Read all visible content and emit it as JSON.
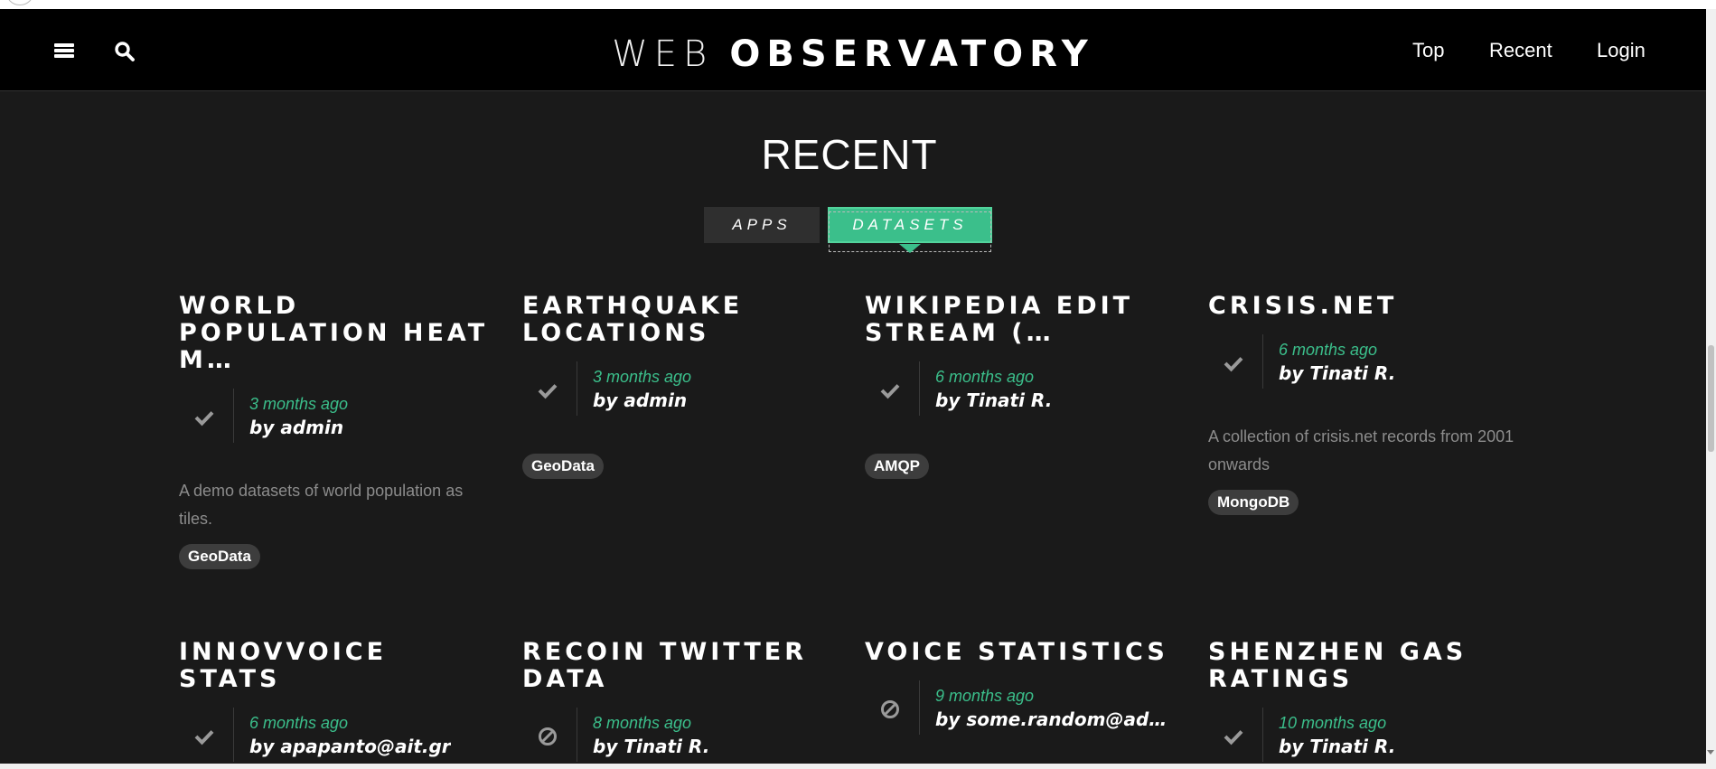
{
  "header": {
    "brand_light": "WEB",
    "brand_bold": "OBSERVATORY",
    "nav": [
      {
        "label": "Top"
      },
      {
        "label": "Recent"
      },
      {
        "label": "Login"
      }
    ]
  },
  "page": {
    "title": "RECENT",
    "tabs": [
      {
        "label": "APPS",
        "active": false
      },
      {
        "label": "DATASETS",
        "active": true
      }
    ]
  },
  "colors": {
    "accent": "#3bbf8b",
    "background": "#1a1a1a",
    "header": "#000000",
    "tag": "#3d3d3d"
  },
  "datasets": [
    {
      "title": "WORLD POPULATION HEAT M…",
      "status_icon": "check-icon",
      "date": "3 months ago",
      "author": "by admin",
      "description": "A demo datasets of world population as tiles.",
      "tag": "GeoData"
    },
    {
      "title": "EARTHQUAKE LOCATIONS",
      "status_icon": "check-icon",
      "date": "3 months ago",
      "author": "by admin",
      "tag": "GeoData"
    },
    {
      "title": "WIKIPEDIA EDIT STREAM (…",
      "status_icon": "check-icon",
      "date": "6 months ago",
      "author": "by Tinati R.",
      "tag": "AMQP"
    },
    {
      "title": "CRISIS.NET",
      "status_icon": "check-icon",
      "date": "6 months ago",
      "author": "by Tinati R.",
      "description": "A collection of crisis.net records from 2001 onwards",
      "tag": "MongoDB"
    },
    {
      "title": "INNOVVOICE STATS",
      "status_icon": "check-icon",
      "date": "6 months ago",
      "author": "by apapanto@ait.gr"
    },
    {
      "title": "RECOIN TWITTER DATA",
      "status_icon": "ban-icon",
      "date": "8 months ago",
      "author": "by Tinati R."
    },
    {
      "title": "VOICE STATISTICS",
      "status_icon": "ban-icon",
      "date": "9 months ago",
      "author": "by some.random@ad…"
    },
    {
      "title": "SHENZHEN GAS RATINGS",
      "status_icon": "check-icon",
      "date": "10 months ago",
      "author": "by Tinati R."
    }
  ]
}
